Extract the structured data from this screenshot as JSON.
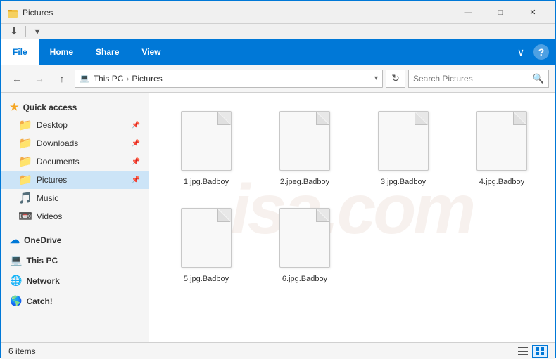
{
  "window": {
    "title": "Pictures",
    "icon": "📁"
  },
  "quickAccessToolbar": {
    "buttons": [
      "properties",
      "new-folder",
      "dropdown"
    ]
  },
  "ribbon": {
    "tabs": [
      "File",
      "Home",
      "Share",
      "View"
    ],
    "activeTab": "File",
    "rightButtons": [
      "chevron",
      "help"
    ]
  },
  "addressBar": {
    "backDisabled": false,
    "forwardDisabled": false,
    "upDisabled": false,
    "path": [
      {
        "label": "This PC",
        "sep": true
      },
      {
        "label": "Pictures",
        "sep": false
      }
    ],
    "searchPlaceholder": "Search Pictures"
  },
  "sidebar": {
    "quickAccessLabel": "Quick access",
    "items": [
      {
        "id": "desktop",
        "label": "Desktop",
        "pinned": true,
        "active": false
      },
      {
        "id": "downloads",
        "label": "Downloads",
        "pinned": true,
        "active": false
      },
      {
        "id": "documents",
        "label": "Documents",
        "pinned": true,
        "active": false
      },
      {
        "id": "pictures",
        "label": "Pictures",
        "pinned": true,
        "active": true
      },
      {
        "id": "music",
        "label": "Music",
        "pinned": false,
        "active": false
      },
      {
        "id": "videos",
        "label": "Videos",
        "pinned": false,
        "active": false
      }
    ],
    "sections": [
      {
        "id": "onedrive",
        "label": "OneDrive"
      },
      {
        "id": "thispc",
        "label": "This PC"
      },
      {
        "id": "network",
        "label": "Network"
      },
      {
        "id": "catch",
        "label": "Catch!"
      }
    ]
  },
  "files": [
    {
      "name": "1.jpg.Badboy",
      "row": 0,
      "col": 0
    },
    {
      "name": "2.jpeg.Badboy",
      "row": 0,
      "col": 1
    },
    {
      "name": "3.jpg.Badboy",
      "row": 0,
      "col": 2
    },
    {
      "name": "4.jpg.Badboy",
      "row": 0,
      "col": 3
    },
    {
      "name": "5.jpg.Badboy",
      "row": 1,
      "col": 0
    },
    {
      "name": "6.jpg.Badboy",
      "row": 1,
      "col": 1
    }
  ],
  "statusBar": {
    "count": "6 items"
  },
  "watermark": "isa.com"
}
